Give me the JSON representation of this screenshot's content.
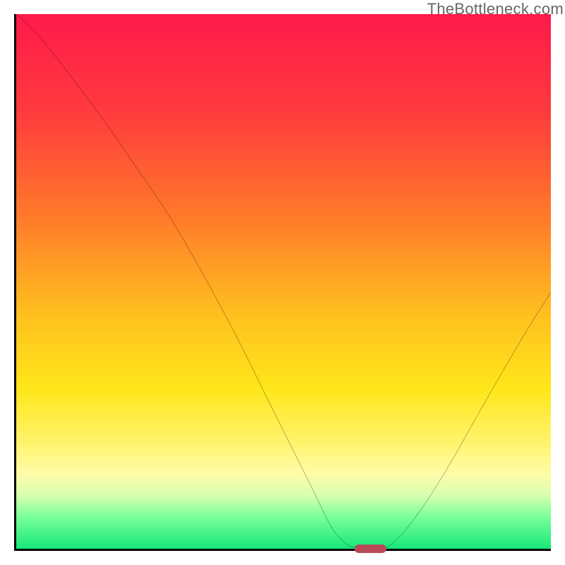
{
  "domain": "Chart",
  "watermark": "TheBottleneck.com",
  "colors": {
    "top": "#ff1a4b",
    "mid1": "#ff7a2a",
    "mid2": "#ffe61a",
    "bottom": "#17e87a",
    "axis": "#000000",
    "curve": "#000000",
    "marker": "#b84a57"
  },
  "chart_data": {
    "type": "line",
    "title": "",
    "xlabel": "",
    "ylabel": "",
    "xlim": [
      0,
      100
    ],
    "ylim": [
      0,
      100
    ],
    "grid": false,
    "curve_points": [
      {
        "x": 0,
        "y": 100
      },
      {
        "x": 5,
        "y": 95
      },
      {
        "x": 15,
        "y": 82
      },
      {
        "x": 22,
        "y": 72
      },
      {
        "x": 30,
        "y": 60
      },
      {
        "x": 40,
        "y": 42
      },
      {
        "x": 48,
        "y": 26
      },
      {
        "x": 55,
        "y": 12
      },
      {
        "x": 59,
        "y": 4
      },
      {
        "x": 62,
        "y": 0.7
      },
      {
        "x": 64,
        "y": 0
      },
      {
        "x": 68,
        "y": 0
      },
      {
        "x": 70,
        "y": 0.7
      },
      {
        "x": 74,
        "y": 5
      },
      {
        "x": 80,
        "y": 14
      },
      {
        "x": 88,
        "y": 28
      },
      {
        "x": 95,
        "y": 40
      },
      {
        "x": 100,
        "y": 48
      }
    ],
    "valley_marker": {
      "x_start": 63,
      "x_end": 69,
      "y": 0
    }
  }
}
